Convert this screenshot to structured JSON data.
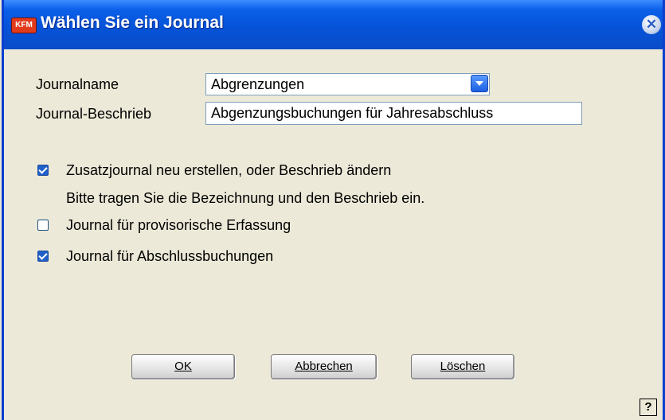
{
  "window": {
    "title": "Wählen Sie ein Journal",
    "app_icon_text": "KFM"
  },
  "form": {
    "journalname_label": "Journalname",
    "journalname_value": "Abgrenzungen",
    "beschrieb_label": "Journal-Beschrieb",
    "beschrieb_value": "Abgenzungsbuchungen für Jahresabschluss"
  },
  "options": {
    "zusatz_label": "Zusatzjournal neu erstellen, oder Beschrieb ändern",
    "zusatz_checked": true,
    "hint": "Bitte tragen Sie die Bezeichnung und den Beschrieb ein.",
    "provisorisch_label": "Journal für provisorische Erfassung",
    "provisorisch_checked": false,
    "abschluss_label": "Journal für Abschlussbuchungen",
    "abschluss_checked": true
  },
  "buttons": {
    "ok": "OK",
    "cancel": "Abbrechen",
    "delete": "Löschen"
  },
  "help_icon": "?",
  "colors": {
    "title_bar": "#0653d8",
    "dialog_bg": "#ece9d8",
    "checkbox_checked": "#2060c8"
  }
}
